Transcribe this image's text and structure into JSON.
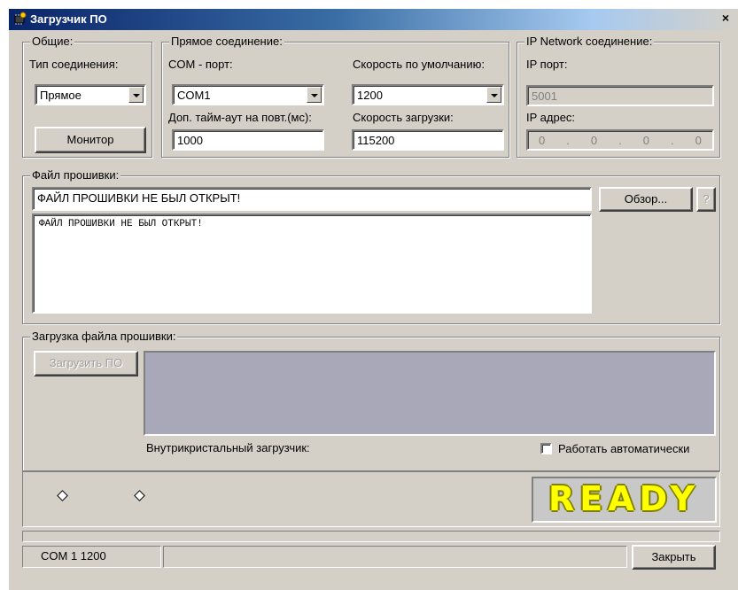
{
  "window": {
    "title": "Загрузчик ПО",
    "close_glyph": "×"
  },
  "general": {
    "legend": "Общие:",
    "connection_type_label": "Тип соединения:",
    "connection_type_value": "Прямое",
    "monitor_button": "Монитор"
  },
  "direct": {
    "legend": "Прямое соединение:",
    "com_port_label": "COM - порт:",
    "com_port_value": "COM1",
    "default_speed_label": "Скорость по умолчанию:",
    "default_speed_value": "1200",
    "retry_timeout_label": "Доп. тайм-аут на повт.(мс):",
    "retry_timeout_value": "1000",
    "load_speed_label": "Скорость загрузки:",
    "load_speed_value": "115200"
  },
  "ip_network": {
    "legend": "IP Network соединение:",
    "port_label": "IP порт:",
    "port_value": "5001",
    "address_label": "IP адрес:",
    "address_octets": [
      "0",
      "0",
      "0",
      "0"
    ],
    "address_separator": "."
  },
  "firmware_file": {
    "legend": "Файл прошивки:",
    "path_value": "ФАЙЛ ПРОШИВКИ НЕ БЫЛ ОТКРЫТ!",
    "browse_button": "Обзор...",
    "help_button": "?",
    "log_text": "ФАЙЛ ПРОШИВКИ НЕ БЫЛ ОТКРЫТ!"
  },
  "firmware_upload": {
    "legend": "Загрузка файла прошивки:",
    "upload_button": "Загрузить ПО",
    "bootloader_label": "Внутрикристальный загрузчик:",
    "auto_checkbox_label": "Работать автоматически",
    "auto_checked": false
  },
  "status": {
    "ready_text": "READY",
    "port_panel": "COM 1   1200",
    "close_button": "Закрыть"
  },
  "colors": {
    "face": "#d4d0c8",
    "title_start": "#0a246a",
    "ready_fill": "#ffff00",
    "progress_bg": "#a8a8b8"
  }
}
